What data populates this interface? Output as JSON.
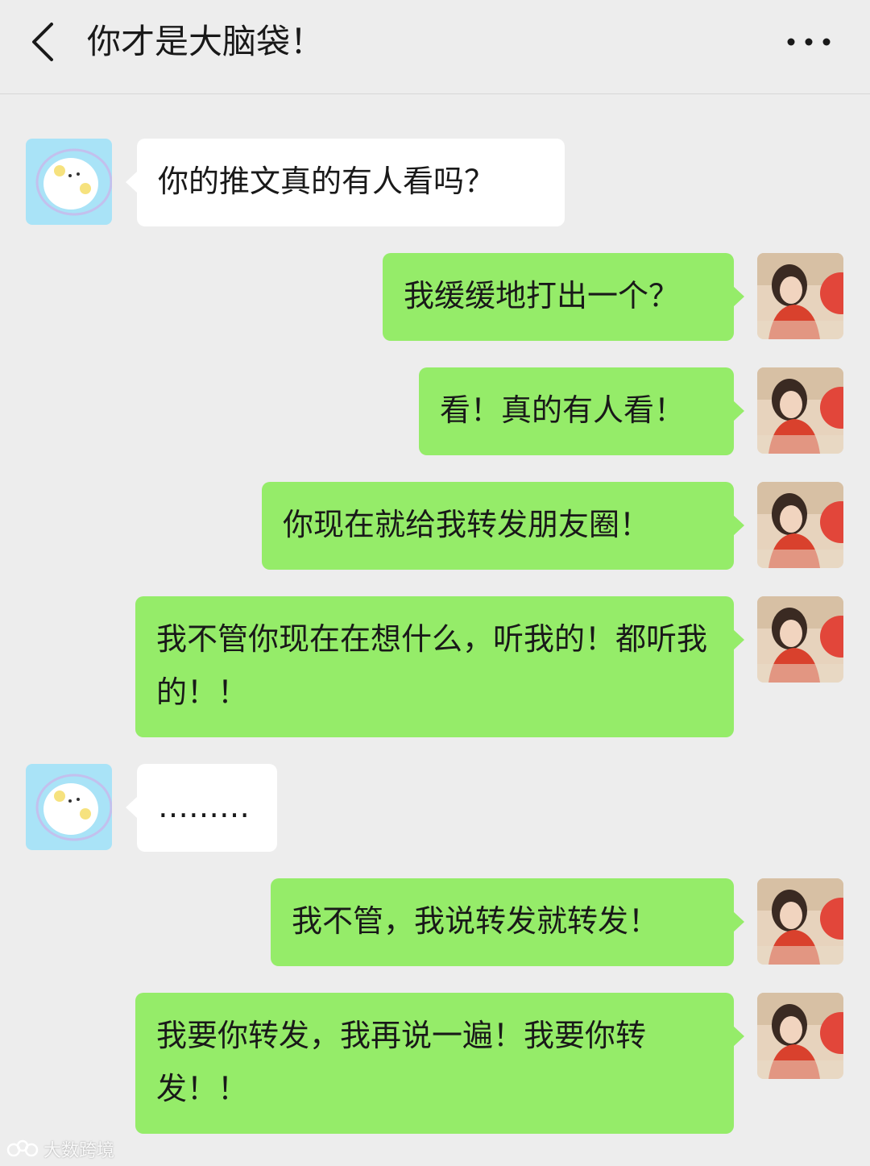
{
  "header": {
    "title": "你才是大脑袋！",
    "back_icon": "chevron-left-icon",
    "more_icon": "more-dots-icon"
  },
  "messages": [
    {
      "side": "left",
      "text": "你的推文真的有人看吗？"
    },
    {
      "side": "right",
      "text": "我缓缓地打出一个？"
    },
    {
      "side": "right",
      "text": "看！真的有人看！"
    },
    {
      "side": "right",
      "text": "你现在就给我转发朋友圈！"
    },
    {
      "side": "right",
      "text": "我不管你现在在想什么，听我的！都听我的！！"
    },
    {
      "side": "left",
      "text": "………"
    },
    {
      "side": "right",
      "text": "我不管，我说转发就转发！"
    },
    {
      "side": "right",
      "text": "我要你转发，我再说一遍！我要你转发！！"
    }
  ],
  "watermark": {
    "text": "大数跨境"
  },
  "colors": {
    "background": "#ededed",
    "bubble_self": "#95ec69",
    "bubble_other": "#ffffff"
  }
}
